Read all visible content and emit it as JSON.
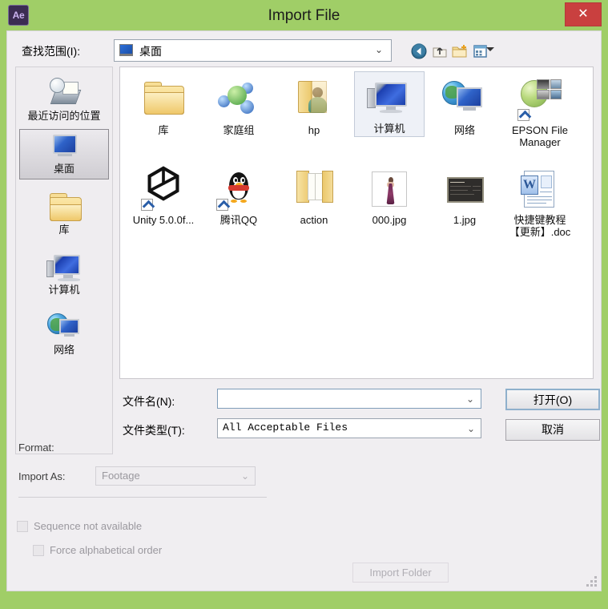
{
  "window": {
    "title": "Import File",
    "app_icon": "Ae",
    "close_label": "✕",
    "frame_color": "#A0CE67",
    "close_color": "#C9403F"
  },
  "toolbar": {
    "lookin_label": "查找范围(I):",
    "lookin_value": "桌面",
    "chevron": "⌄",
    "icons": [
      {
        "name": "back-icon",
        "title": "后退"
      },
      {
        "name": "up-one-level-icon",
        "title": "向上一级"
      },
      {
        "name": "new-folder-icon",
        "title": "新建文件夹"
      },
      {
        "name": "views-icon",
        "title": "视图"
      }
    ]
  },
  "places": [
    {
      "label": "最近访问的位置",
      "icon": "recent-places-icon",
      "selected": false
    },
    {
      "label": "桌面",
      "icon": "desktop-icon",
      "selected": true
    },
    {
      "label": "库",
      "icon": "library-icon",
      "selected": false
    },
    {
      "label": "计算机",
      "icon": "computer-icon",
      "selected": false
    },
    {
      "label": "网络",
      "icon": "network-icon",
      "selected": false
    }
  ],
  "files": [
    {
      "label": "库",
      "icon": "library-folder-icon",
      "selected": false
    },
    {
      "label": "家庭组",
      "icon": "homegroup-icon",
      "selected": false
    },
    {
      "label": "hp",
      "icon": "user-folder-icon",
      "selected": false
    },
    {
      "label": "计算机",
      "icon": "computer-icon",
      "selected": true
    },
    {
      "label": "网络",
      "icon": "network-icon",
      "selected": false
    },
    {
      "label": "EPSON File Manager",
      "icon": "epson-file-manager-icon",
      "selected": false
    },
    {
      "label": "Unity 5.0.0f...",
      "icon": "unity-shortcut-icon",
      "selected": false
    },
    {
      "label": "腾讯QQ",
      "icon": "qq-shortcut-icon",
      "selected": false
    },
    {
      "label": "action",
      "icon": "folder-icon",
      "selected": false
    },
    {
      "label": "000.jpg",
      "icon": "image-thumbnail-icon",
      "selected": false
    },
    {
      "label": "1.jpg",
      "icon": "image-thumbnail-dark-icon",
      "selected": false
    },
    {
      "label": "快捷键教程【更新】.doc",
      "icon": "word-document-icon",
      "selected": false
    }
  ],
  "form": {
    "filename_label": "文件名(N):",
    "filename_value": "",
    "filename_placeholder": "",
    "filetype_label": "文件类型(T):",
    "filetype_value": "All Acceptable Files",
    "chevron": "⌄",
    "open_label": "打开(O)",
    "cancel_label": "取消"
  },
  "options": {
    "format_label": "Format:",
    "format_value": "",
    "importas_label": "Import As:",
    "importas_value": "Footage",
    "chevron": "⌄",
    "sequence_label": "Sequence not available",
    "force_label": "Force alphabetical order",
    "import_folder_label": "Import Folder"
  }
}
